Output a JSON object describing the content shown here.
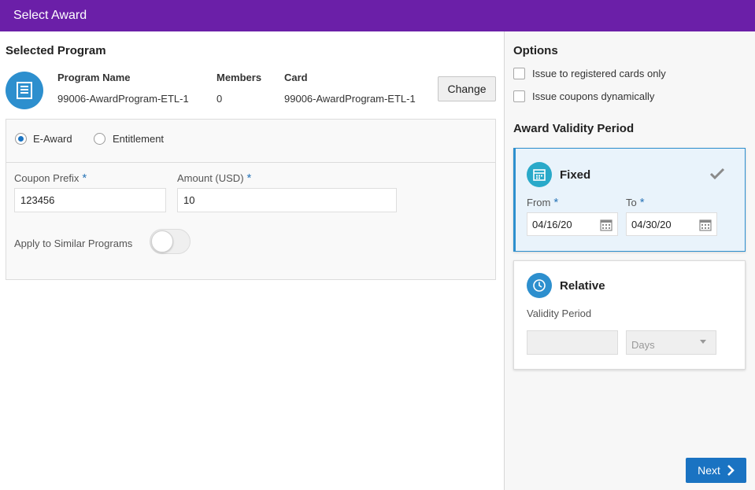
{
  "window": {
    "title": "Select Award"
  },
  "selected_program": {
    "heading": "Selected Program",
    "columns": {
      "program_name": "Program Name",
      "members": "Members",
      "card": "Card"
    },
    "values": {
      "program_name": "99006-AwardProgram-ETL-1",
      "members": "0",
      "card": "99006-AwardProgram-ETL-1"
    },
    "change_label": "Change"
  },
  "award_type": {
    "options": [
      {
        "label": "E-Award",
        "selected": true
      },
      {
        "label": "Entitlement",
        "selected": false
      }
    ]
  },
  "form": {
    "coupon_prefix": {
      "label": "Coupon Prefix",
      "value": "123456"
    },
    "amount": {
      "label": "Amount (USD)",
      "value": "10"
    },
    "required_mark": "*",
    "apply_similar": {
      "label": "Apply to Similar Programs",
      "on": false
    }
  },
  "options": {
    "heading": "Options",
    "items": [
      {
        "label": "Issue to registered cards only",
        "checked": false
      },
      {
        "label": "Issue coupons dynamically",
        "checked": false
      }
    ]
  },
  "validity": {
    "heading": "Award Validity Period",
    "fixed": {
      "title": "Fixed",
      "from_label": "From",
      "to_label": "To",
      "from_value": "04/16/20",
      "to_value": "04/30/20",
      "selected": true
    },
    "relative": {
      "title": "Relative",
      "period_label": "Validity Period",
      "unit_value": "Days",
      "selected": false
    }
  },
  "footer": {
    "next_label": "Next"
  },
  "colors": {
    "titlebar": "#6b1fa8",
    "accent": "#1a73c2",
    "icon_blue": "#2d8fce",
    "card_selected_bg": "#e9f3fb"
  }
}
